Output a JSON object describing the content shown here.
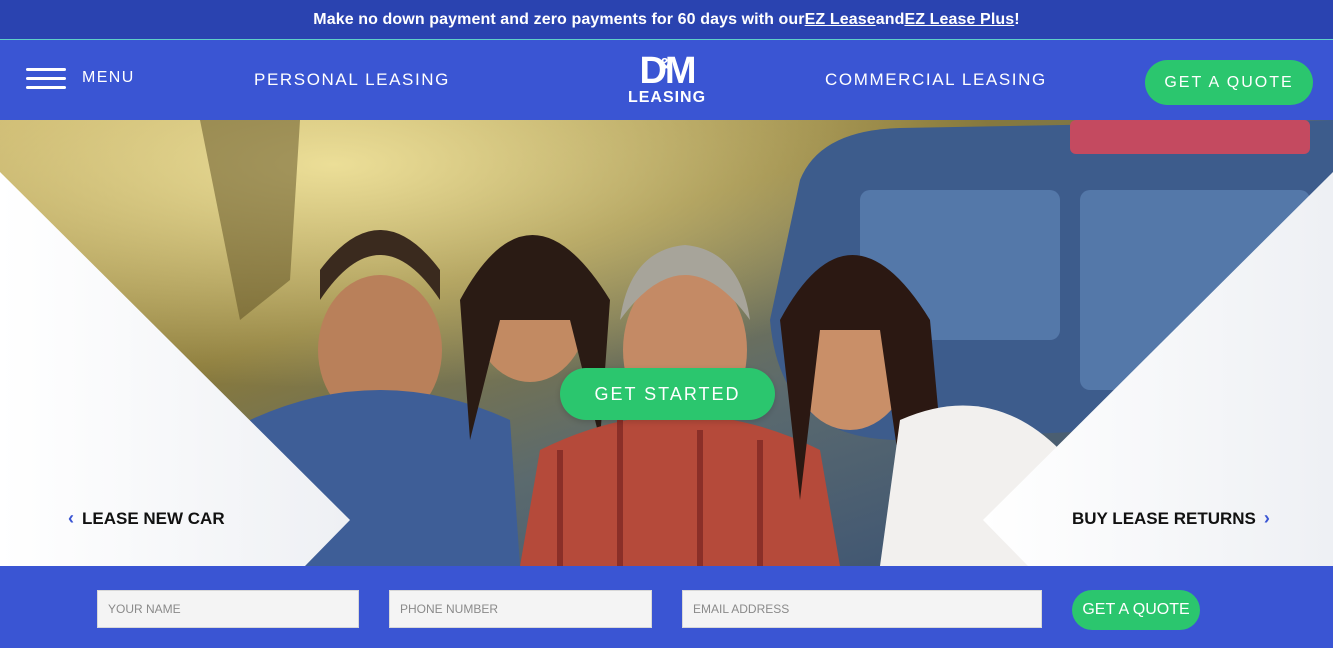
{
  "promo": {
    "text_before": "Make no down payment and zero payments for 60 days with our ",
    "link1": "EZ Lease",
    "text_mid": " and ",
    "link2": "EZ Lease Plus",
    "text_after": "!"
  },
  "nav": {
    "menu_label": "MENU",
    "personal": "PERSONAL LEASING",
    "commercial": "COMMERCIAL LEASING",
    "quote": "GET A QUOTE"
  },
  "logo": {
    "dm": "DM",
    "amp": "&",
    "leasing": "LEASING"
  },
  "hero": {
    "cta": "GET STARTED",
    "left_link": "LEASE NEW CAR",
    "right_link": "BUY LEASE RETURNS",
    "left_chevron": "‹",
    "right_chevron": "›"
  },
  "form": {
    "name_placeholder": "YOUR NAME",
    "phone_placeholder": "PHONE NUMBER",
    "email_placeholder": "EMAIL ADDRESS",
    "submit": "GET A QUOTE"
  },
  "colors": {
    "brand_blue": "#3a55d3",
    "banner_blue": "#2a43b0",
    "accent_green": "#2bc66e"
  },
  "icons": [
    "hamburger-menu-icon",
    "chevron-left-icon",
    "chevron-right-icon"
  ]
}
